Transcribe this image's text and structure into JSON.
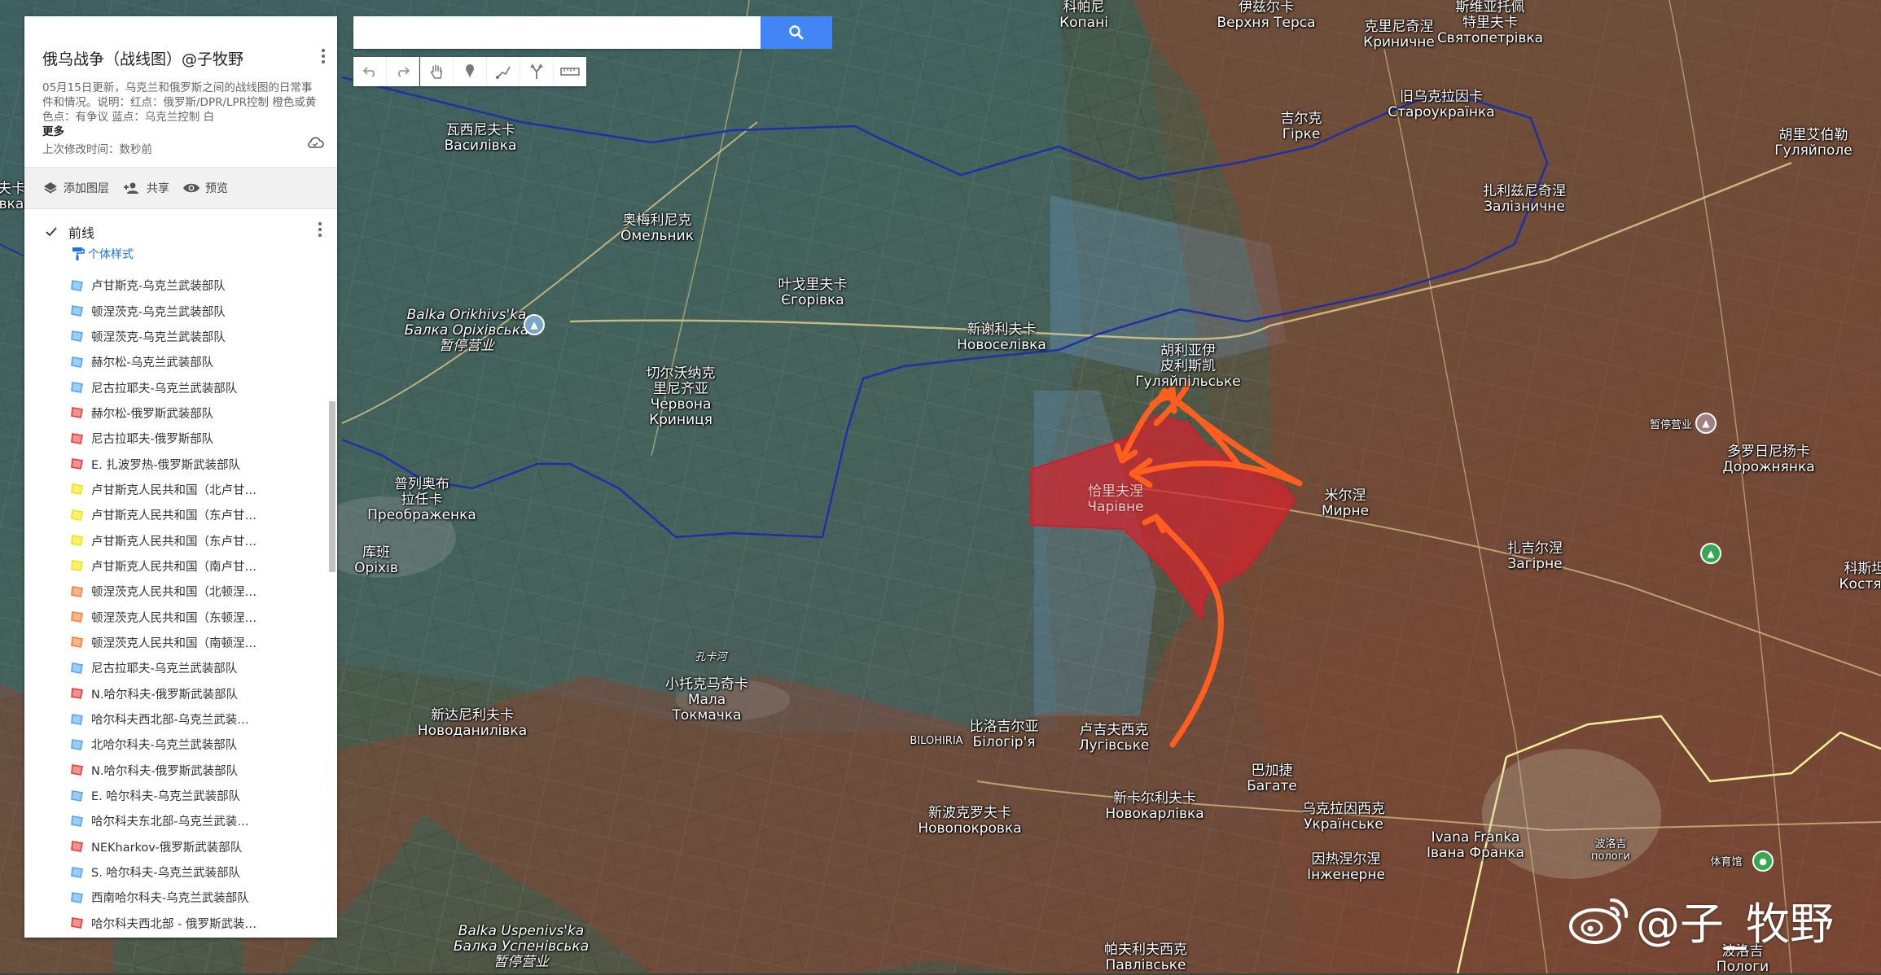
{
  "panel": {
    "title": "俄乌战争（战线图）@子牧野",
    "description": "05月15日更新，乌克兰和俄罗斯之间的战线图的日常事件和情况。说明：红点：俄罗斯/DPR/LPR控制 橙色或黄色点：有争议 蓝点：乌克兰控制 白",
    "more": "更多",
    "modified": "上次修改时间：数秒前",
    "actions": {
      "add_layer": "添加图层",
      "share": "共享",
      "preview": "预览"
    },
    "layer": {
      "title": "前线",
      "style": "个体样式",
      "items": [
        {
          "label": "卢甘斯克-乌克兰武装部队",
          "color": "#4da3ff"
        },
        {
          "label": "顿涅茨克-乌克兰武装部队",
          "color": "#4da3ff"
        },
        {
          "label": "顿涅茨克-乌克兰武装部队",
          "color": "#4da3ff"
        },
        {
          "label": "赫尔松-乌克兰武装部队",
          "color": "#4da3ff"
        },
        {
          "label": "尼古拉耶夫-乌克兰武装部队",
          "color": "#4da3ff"
        },
        {
          "label": "赫尔松-俄罗斯武装部队",
          "color": "#e53935"
        },
        {
          "label": "尼古拉耶夫-俄罗斯部队",
          "color": "#e53935"
        },
        {
          "label": "E. 扎波罗热-俄罗斯武装部队",
          "color": "#e53935"
        },
        {
          "label": "卢甘斯克人民共和国（北卢甘…",
          "color": "#f5e400"
        },
        {
          "label": "卢甘斯克人民共和国（东卢甘…",
          "color": "#f5e400"
        },
        {
          "label": "卢甘斯克人民共和国（东卢甘…",
          "color": "#f5e400"
        },
        {
          "label": "卢甘斯克人民共和国（南卢甘…",
          "color": "#f5e400"
        },
        {
          "label": "顿涅茨克人民共和国（北顿涅…",
          "color": "#ff7a2e"
        },
        {
          "label": "顿涅茨克人民共和国（东顿涅…",
          "color": "#ff7a2e"
        },
        {
          "label": "顿涅茨克人民共和国（南顿涅…",
          "color": "#ff7a2e"
        },
        {
          "label": "尼古拉耶夫-乌克兰武装部队",
          "color": "#4da3ff"
        },
        {
          "label": "N.哈尔科夫-俄罗斯武装部队",
          "color": "#e53935"
        },
        {
          "label": "哈尔科夫西北部-乌克兰武装…",
          "color": "#4da3ff"
        },
        {
          "label": "北哈尔科夫-乌克兰武装部队",
          "color": "#4da3ff"
        },
        {
          "label": "N.哈尔科夫-俄罗斯武装部队",
          "color": "#e53935"
        },
        {
          "label": "E. 哈尔科夫-乌克兰武装部队",
          "color": "#4da3ff"
        },
        {
          "label": "哈尔科夫东北部-乌克兰武装…",
          "color": "#4da3ff"
        },
        {
          "label": "NEKharkov-俄罗斯武装部队",
          "color": "#e53935"
        },
        {
          "label": "S. 哈尔科夫-乌克兰武装部队",
          "color": "#4da3ff"
        },
        {
          "label": "西南哈尔科夫-乌克兰武装部队",
          "color": "#4da3ff"
        },
        {
          "label": "哈尔科夫西北部 - 俄罗斯武装…",
          "color": "#e53935"
        }
      ]
    }
  },
  "search": {
    "placeholder": ""
  },
  "watermark": "@子_牧野",
  "icons": {
    "search": "search-icon",
    "undo": "undo-icon",
    "redo": "redo-icon",
    "pan": "hand-icon",
    "marker": "marker-icon",
    "line": "draw-line-icon",
    "route": "route-icon",
    "measure": "ruler-icon"
  },
  "places": [
    {
      "name": "kopani",
      "l1": "科帕尼",
      "l2": "Копані"
    },
    {
      "name": "verkhnia-tersa",
      "l1": "伊兹尔卡",
      "l2": "Верхня Терса"
    },
    {
      "name": "krynychne",
      "l1": "克里尼奇涅",
      "l2": "Криничне"
    },
    {
      "name": "sviatopetrivka",
      "l1": "斯维亚托佩",
      "l2": "特里夫卡",
      "l3": "Святопетрівка"
    },
    {
      "name": "vasynivka",
      "l1": "瓦西尼夫卡",
      "l2": "Василівка"
    },
    {
      "name": "staroukrainka",
      "l1": "旧乌克拉因卡",
      "l2": "Староукраїнка"
    },
    {
      "name": "hirke",
      "l1": "吉尔克",
      "l2": "Гірке"
    },
    {
      "name": "huliaipole",
      "l1": "胡里艾伯勒",
      "l2": "Гуляйполе"
    },
    {
      "name": "omelnyk",
      "l1": "奥梅利尼克",
      "l2": "Омельник"
    },
    {
      "name": "zaliznychne",
      "l1": "扎利兹尼奇涅",
      "l2": "Залізничне"
    },
    {
      "name": "yehorivka",
      "l1": "叶戈里夫卡",
      "l2": "Єгорівка"
    },
    {
      "name": "balka-orikhivska",
      "l1": "Balka Orikhivs'ka",
      "l2": "Балка Оріхівська",
      "l3": "暂停营业"
    },
    {
      "name": "novoselivka",
      "l1": "新谢利夫卡",
      "l2": "Новоселівка"
    },
    {
      "name": "huliaipilske",
      "l1": "胡利亚伊",
      "l2": "皮利斯凯",
      "l3": "Гуляйпільське"
    },
    {
      "name": "chervona-krynytsia",
      "l1": "切尔沃纳克",
      "l2": "里尼齐亚",
      "l3": "Червона",
      "l4": "Криниця"
    },
    {
      "name": "poi-closed",
      "l1": "暂停营业"
    },
    {
      "name": "dorozhnianka",
      "l1": "多罗日尼扬卡",
      "l2": "Дорожнянка"
    },
    {
      "name": "preobrazhenka",
      "l1": "普列奥布",
      "l2": "拉任卡",
      "l3": "Преображенка"
    },
    {
      "name": "charivne",
      "l1": "恰里夫涅",
      "l2": "Чарівне"
    },
    {
      "name": "myrne",
      "l1": "米尔涅",
      "l2": "Мирне"
    },
    {
      "name": "orikhiv",
      "l1": "库班",
      "l2": "Оріхів"
    },
    {
      "name": "zahirne",
      "l1": "扎吉尔涅",
      "l2": "Загірне"
    },
    {
      "name": "kostiantynivka",
      "l1": "科斯坦",
      "l2": "Костян"
    },
    {
      "name": "mala-tokmachka",
      "l1": "小托克马奇卡",
      "l2": "Мала",
      "l3": "Токмачка"
    },
    {
      "name": "novodanylivka",
      "l1": "新达尼利夫卡",
      "l2": "Новоданилівка"
    },
    {
      "name": "bilohiria",
      "l1": "比洛吉尔亚",
      "l2": "Білогір'я"
    },
    {
      "name": "luhivske",
      "l1": "卢吉夫西克",
      "l2": "Лугівське"
    },
    {
      "name": "bahate",
      "l1": "巴加捷",
      "l2": "Багате"
    },
    {
      "name": "novokarlivka",
      "l1": "新卡尔利夫卡",
      "l2": "Новокарлівка"
    },
    {
      "name": "novopokrovka",
      "l1": "新波克罗夫卡",
      "l2": "Новопокровка"
    },
    {
      "name": "ukrainske",
      "l1": "乌克拉因西克",
      "l2": "Українське"
    },
    {
      "name": "inzhenerne",
      "l1": "因热涅尔涅",
      "l2": "Інженерне"
    },
    {
      "name": "ivana-franka",
      "l1": "Ivana Franka",
      "l2": "Івана Франка"
    },
    {
      "name": "balka-uspenivska",
      "l1": "Balka Uspenivs'ka",
      "l2": "Балка Успенівська",
      "l3": "暂停营业"
    },
    {
      "name": "pavlivske",
      "l1": "帕夫利夫西克",
      "l2": "Павлівське"
    },
    {
      "name": "polohy",
      "l1": "波洛吉",
      "l2": "Пологи"
    },
    {
      "name": "polohy-small",
      "l1": "波洛吉",
      "l2": "пологи"
    },
    {
      "name": "sports",
      "l1": "体育馆"
    },
    {
      "name": "bilohiria-road",
      "l1": "BILOHIRIA"
    },
    {
      "name": "river",
      "l1": "孔卡河"
    },
    {
      "name": "left-edge",
      "l1": "夫卡",
      "l2": "вка"
    },
    {
      "name": "right-edge",
      "l1": "科利亚",
      "l2": "Кості"
    }
  ]
}
